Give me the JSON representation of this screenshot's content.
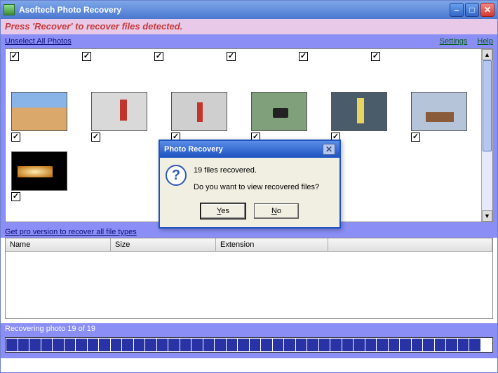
{
  "window": {
    "title": "Asoftech Photo Recovery"
  },
  "banner": {
    "text": "Press 'Recover' to recover files detected."
  },
  "toolbar": {
    "unselect": "Unselect All Photos",
    "settings": "Settings",
    "help": "Help"
  },
  "prolink": {
    "label": "Get pro version to recover all file types"
  },
  "table": {
    "headers": {
      "name": "Name",
      "size": "Size",
      "ext": "Extension"
    }
  },
  "status": {
    "text": "Recovering photo 19 of 19"
  },
  "progress": {
    "segments": 42,
    "filled": 41
  },
  "dialog": {
    "title": "Photo Recovery",
    "line1": "19 files recovered.",
    "line2": "Do you want to view recovered files?",
    "yes": "Yes",
    "no": "No"
  }
}
